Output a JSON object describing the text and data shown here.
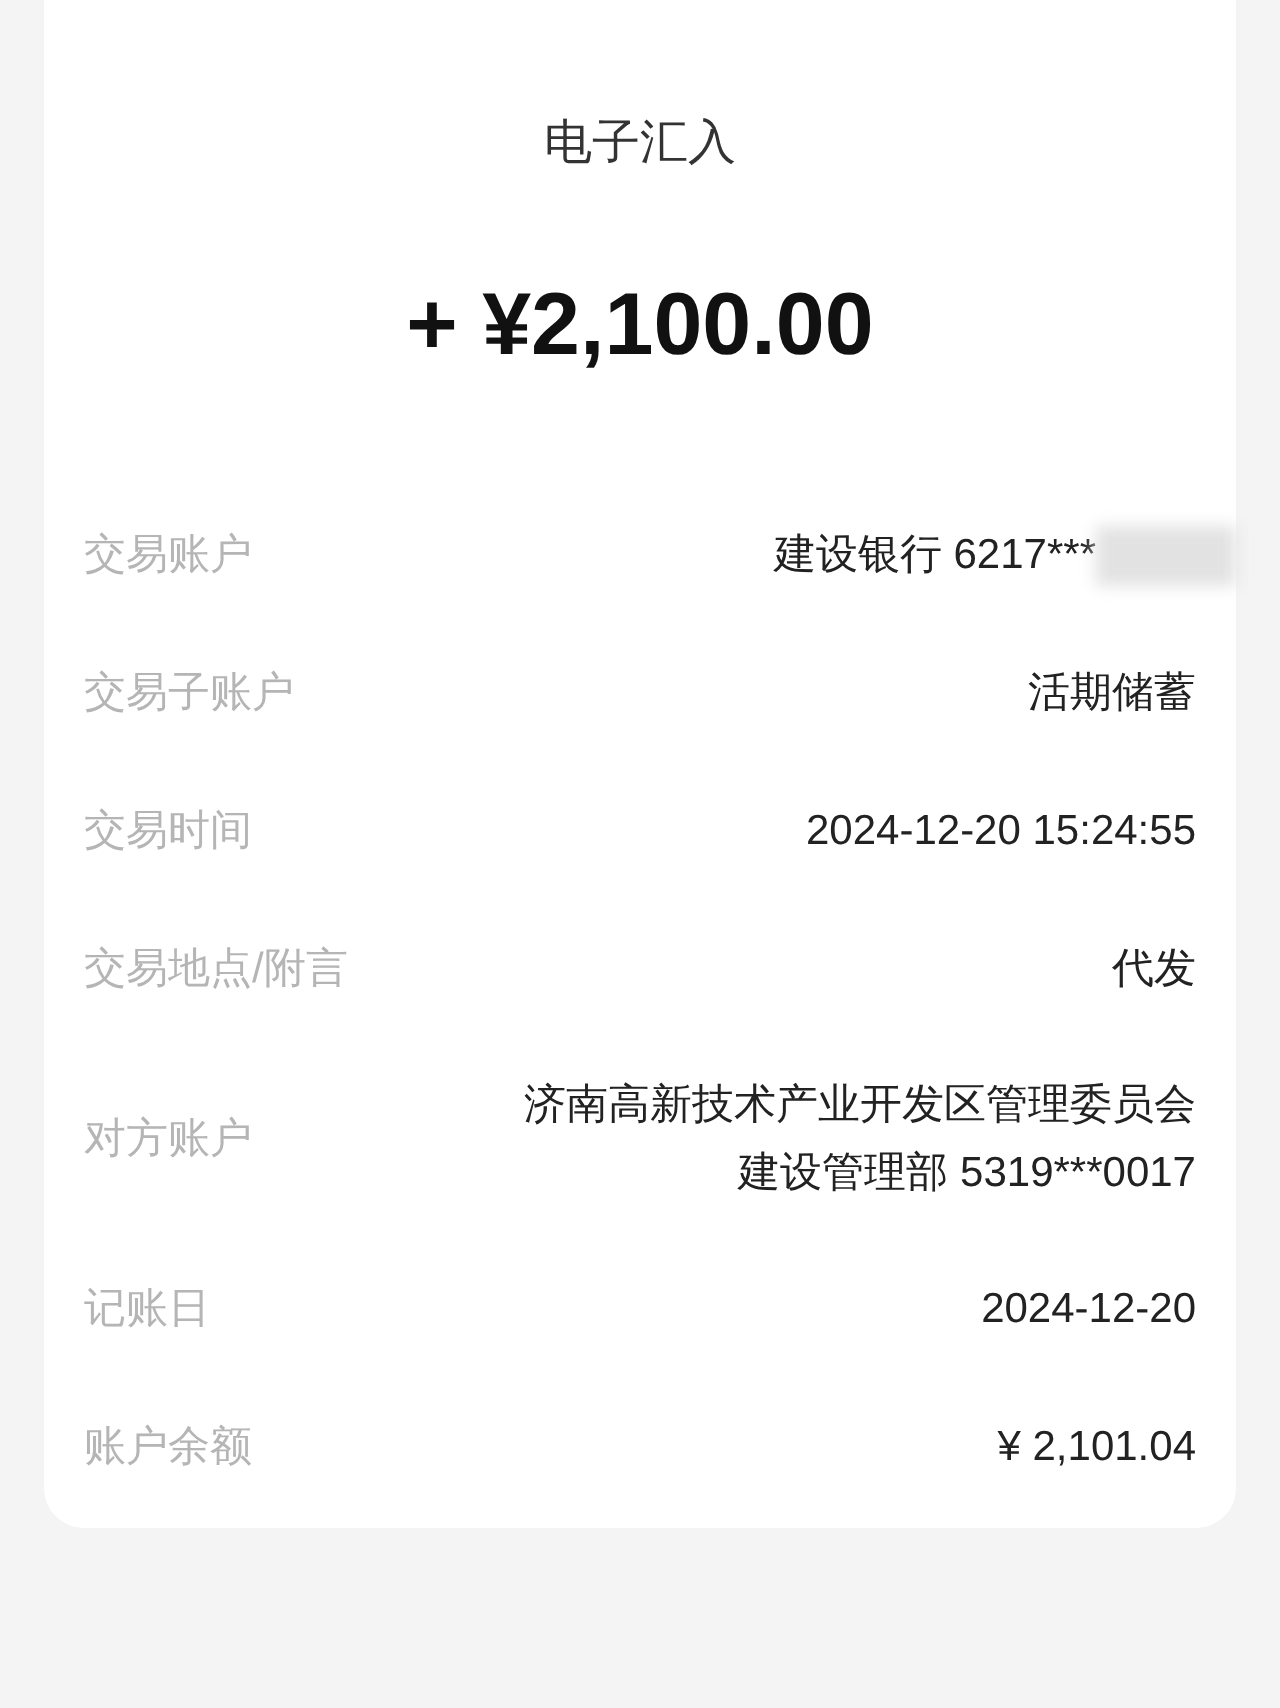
{
  "title": "电子汇入",
  "amount": "+ ¥2,100.00",
  "rows": [
    {
      "label": "交易账户",
      "value": [
        "建设银行 6217***"
      ],
      "redacted": true
    },
    {
      "label": "交易子账户",
      "value": [
        "活期储蓄"
      ],
      "redacted": false
    },
    {
      "label": "交易时间",
      "value": [
        "2024-12-20 15:24:55"
      ],
      "redacted": false
    },
    {
      "label": "交易地点/附言",
      "value": [
        "代发"
      ],
      "redacted": false
    },
    {
      "label": "对方账户",
      "value": [
        "济南高新技术产业开发区管理委员会",
        "建设管理部 5319***0017"
      ],
      "redacted": false
    },
    {
      "label": "记账日",
      "value": [
        "2024-12-20"
      ],
      "redacted": false
    },
    {
      "label": "账户余额",
      "value": [
        "¥ 2,101.04"
      ],
      "redacted": false
    }
  ]
}
